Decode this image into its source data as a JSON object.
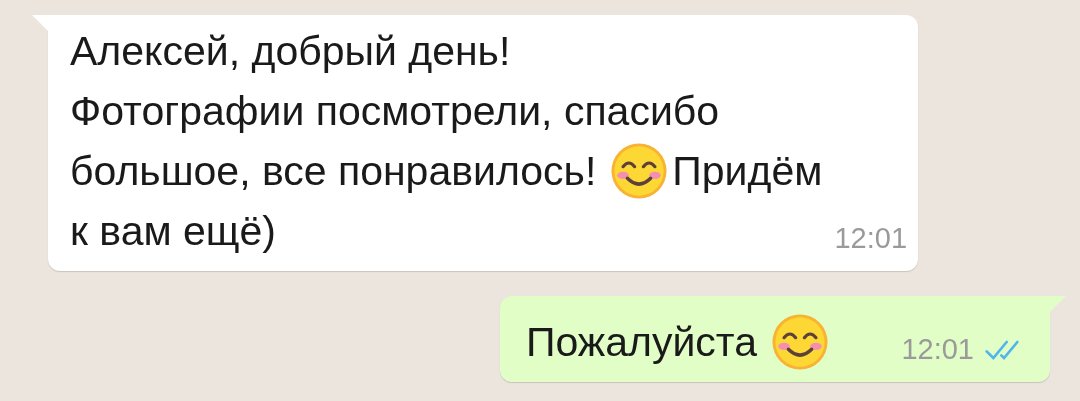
{
  "messages": [
    {
      "kind": "incoming",
      "lines": [
        [
          {
            "kind": "text",
            "text": "Алексей, добрый день!"
          }
        ],
        [
          {
            "kind": "text",
            "text": "Фотографии посмотрели, спасибо"
          }
        ],
        [
          {
            "kind": "text",
            "text": "большое, все понравилось!"
          },
          {
            "kind": "emoji"
          },
          {
            "kind": "text",
            "text": "Придём"
          }
        ],
        [
          {
            "kind": "text",
            "text": "к вам ещё)"
          }
        ]
      ],
      "time": "12:01"
    },
    {
      "kind": "outgoing",
      "lines": [
        [
          {
            "kind": "text",
            "text": "Пожалуйста"
          },
          {
            "kind": "emoji"
          }
        ]
      ],
      "time": "12:01",
      "read": true
    }
  ]
}
